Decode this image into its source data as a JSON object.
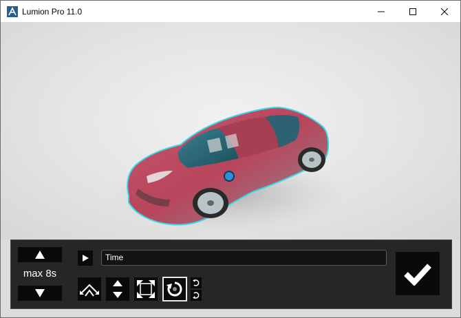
{
  "window": {
    "title": "Lumion Pro 11.0",
    "controls": [
      "minimize-icon",
      "maximize-icon",
      "close-icon"
    ]
  },
  "viewport": {
    "subject": "red sports car, selected (cyan outline)",
    "colors": {
      "car_body": "#b8455c",
      "selection_outline": "#38d7e6",
      "background": "#e2e2e2"
    }
  },
  "panel": {
    "duration_label": "max 8s",
    "duration_up_icon": "triangle-up-icon",
    "duration_down_icon": "triangle-down-icon",
    "play_icon": "play-icon",
    "time_field_value": "Time",
    "tools": [
      {
        "name": "move-horizontal-tool",
        "icon": "move-arrows-icon",
        "active": false
      },
      {
        "name": "move-vertical-tool",
        "icon": "up-down-arrows-icon",
        "active": false
      },
      {
        "name": "scale-tool",
        "icon": "expand-corners-icon",
        "active": false
      },
      {
        "name": "rotate-tool",
        "icon": "rotate-icon",
        "active": true
      }
    ],
    "rotate_direction_icons": [
      "rotate-cw-small-icon",
      "rotate-ccw-small-icon"
    ],
    "confirm_icon": "checkmark-icon",
    "colors": {
      "panel_bg": "#262626",
      "button_bg": "#0a0a0a",
      "text": "#ffffff"
    }
  }
}
